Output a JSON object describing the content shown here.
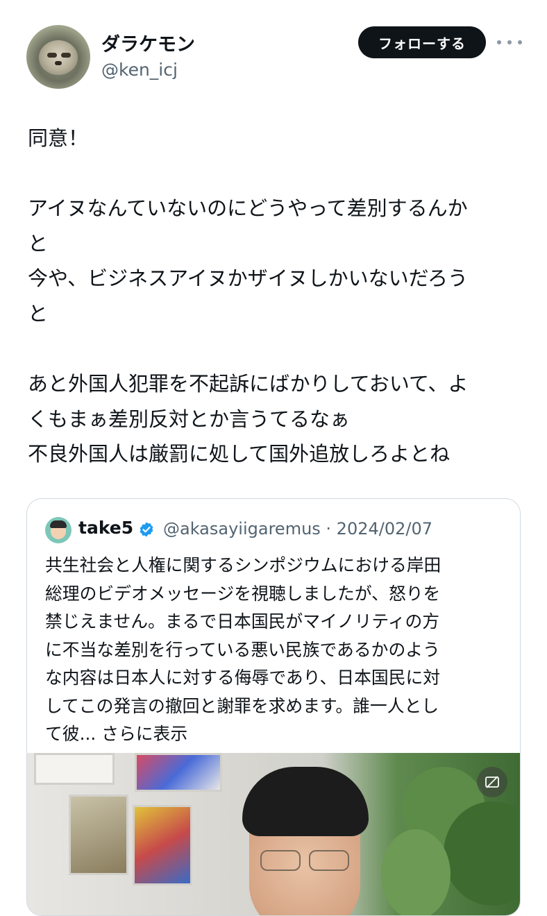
{
  "author": {
    "display_name": "ダラケモン",
    "handle": "@ken_icj"
  },
  "actions": {
    "follow_label": "フォローする"
  },
  "post": {
    "text": "同意！\n\nアイヌなんていないのにどうやって差別するんか\nと\n今や、ビジネスアイヌかザイヌしかいないだろう\nと\n\nあと外国人犯罪を不起訴にばかりしておいて、よ\nくもまぁ差別反対とか言うてるなぁ\n不良外国人は厳罰に処して国外追放しろよとね"
  },
  "quoted_post": {
    "name": "take5",
    "handle_date": "@akasayiigaremus · 2024/02/07",
    "text": "共生社会と人権に関するシンポジウムにおける岸田\n総理のビデオメッセージを視聴しましたが、怒りを\n禁じえません。まるで日本国民がマイノリティの方\nに不当な差別を行っている悪い民族であるかのよう\nな内容は日本人に対する侮辱であり、日本国民に対\nしてこの発言の撤回と謝罪を求めます。誰一人とし\nて彼...",
    "show_more": "さらに表示"
  },
  "colors": {
    "text": "#0f1419",
    "secondary": "#536471",
    "verified": "#1d9bf0",
    "border": "#cfd9de"
  }
}
